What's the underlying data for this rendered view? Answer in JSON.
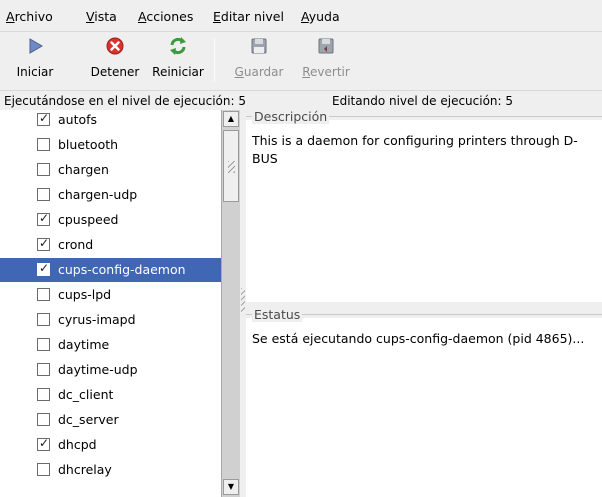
{
  "menubar": {
    "items": [
      {
        "mnemonic": "A",
        "rest": "rchivo"
      },
      {
        "mnemonic": "V",
        "rest": "ista"
      },
      {
        "mnemonic": "A",
        "rest": "cciones"
      },
      {
        "mnemonic": "E",
        "rest": "ditar nivel"
      },
      {
        "mnemonic": "A",
        "rest": "yuda"
      }
    ]
  },
  "toolbar": {
    "start": {
      "label": "Iniciar",
      "icon": "play-icon"
    },
    "stop": {
      "label": "Detener",
      "icon": "stop-icon"
    },
    "restart": {
      "label": "Reiniciar",
      "icon": "restart-icon"
    },
    "save": {
      "label_mn": "G",
      "label_rest": "uardar",
      "icon": "floppy-icon"
    },
    "revert": {
      "label_mn": "R",
      "label_rest": "evertir",
      "icon": "revert-icon"
    }
  },
  "status": {
    "running": "Ejecutándose en el nivel de ejecución: 5",
    "editing": "Editando nivel de ejecución: 5"
  },
  "services": [
    {
      "name": "autofs",
      "checked": true
    },
    {
      "name": "bluetooth",
      "checked": false
    },
    {
      "name": "chargen",
      "checked": false
    },
    {
      "name": "chargen-udp",
      "checked": false
    },
    {
      "name": "cpuspeed",
      "checked": true
    },
    {
      "name": "crond",
      "checked": true
    },
    {
      "name": "cups-config-daemon",
      "checked": true,
      "selected": true
    },
    {
      "name": "cups-lpd",
      "checked": false
    },
    {
      "name": "cyrus-imapd",
      "checked": false
    },
    {
      "name": "daytime",
      "checked": false
    },
    {
      "name": "daytime-udp",
      "checked": false
    },
    {
      "name": "dc_client",
      "checked": false
    },
    {
      "name": "dc_server",
      "checked": false
    },
    {
      "name": "dhcpd",
      "checked": true
    },
    {
      "name": "dhcrelay",
      "checked": false
    }
  ],
  "description": {
    "title": "Descripción",
    "text": "This is a daemon for configuring printers through D-BUS"
  },
  "statuspane": {
    "title": "Estatus",
    "text": "Se está ejecutando cups-config-daemon (pid 4865)..."
  },
  "colors": {
    "selection": "#3f67b3",
    "window_bg": "#efefef"
  }
}
